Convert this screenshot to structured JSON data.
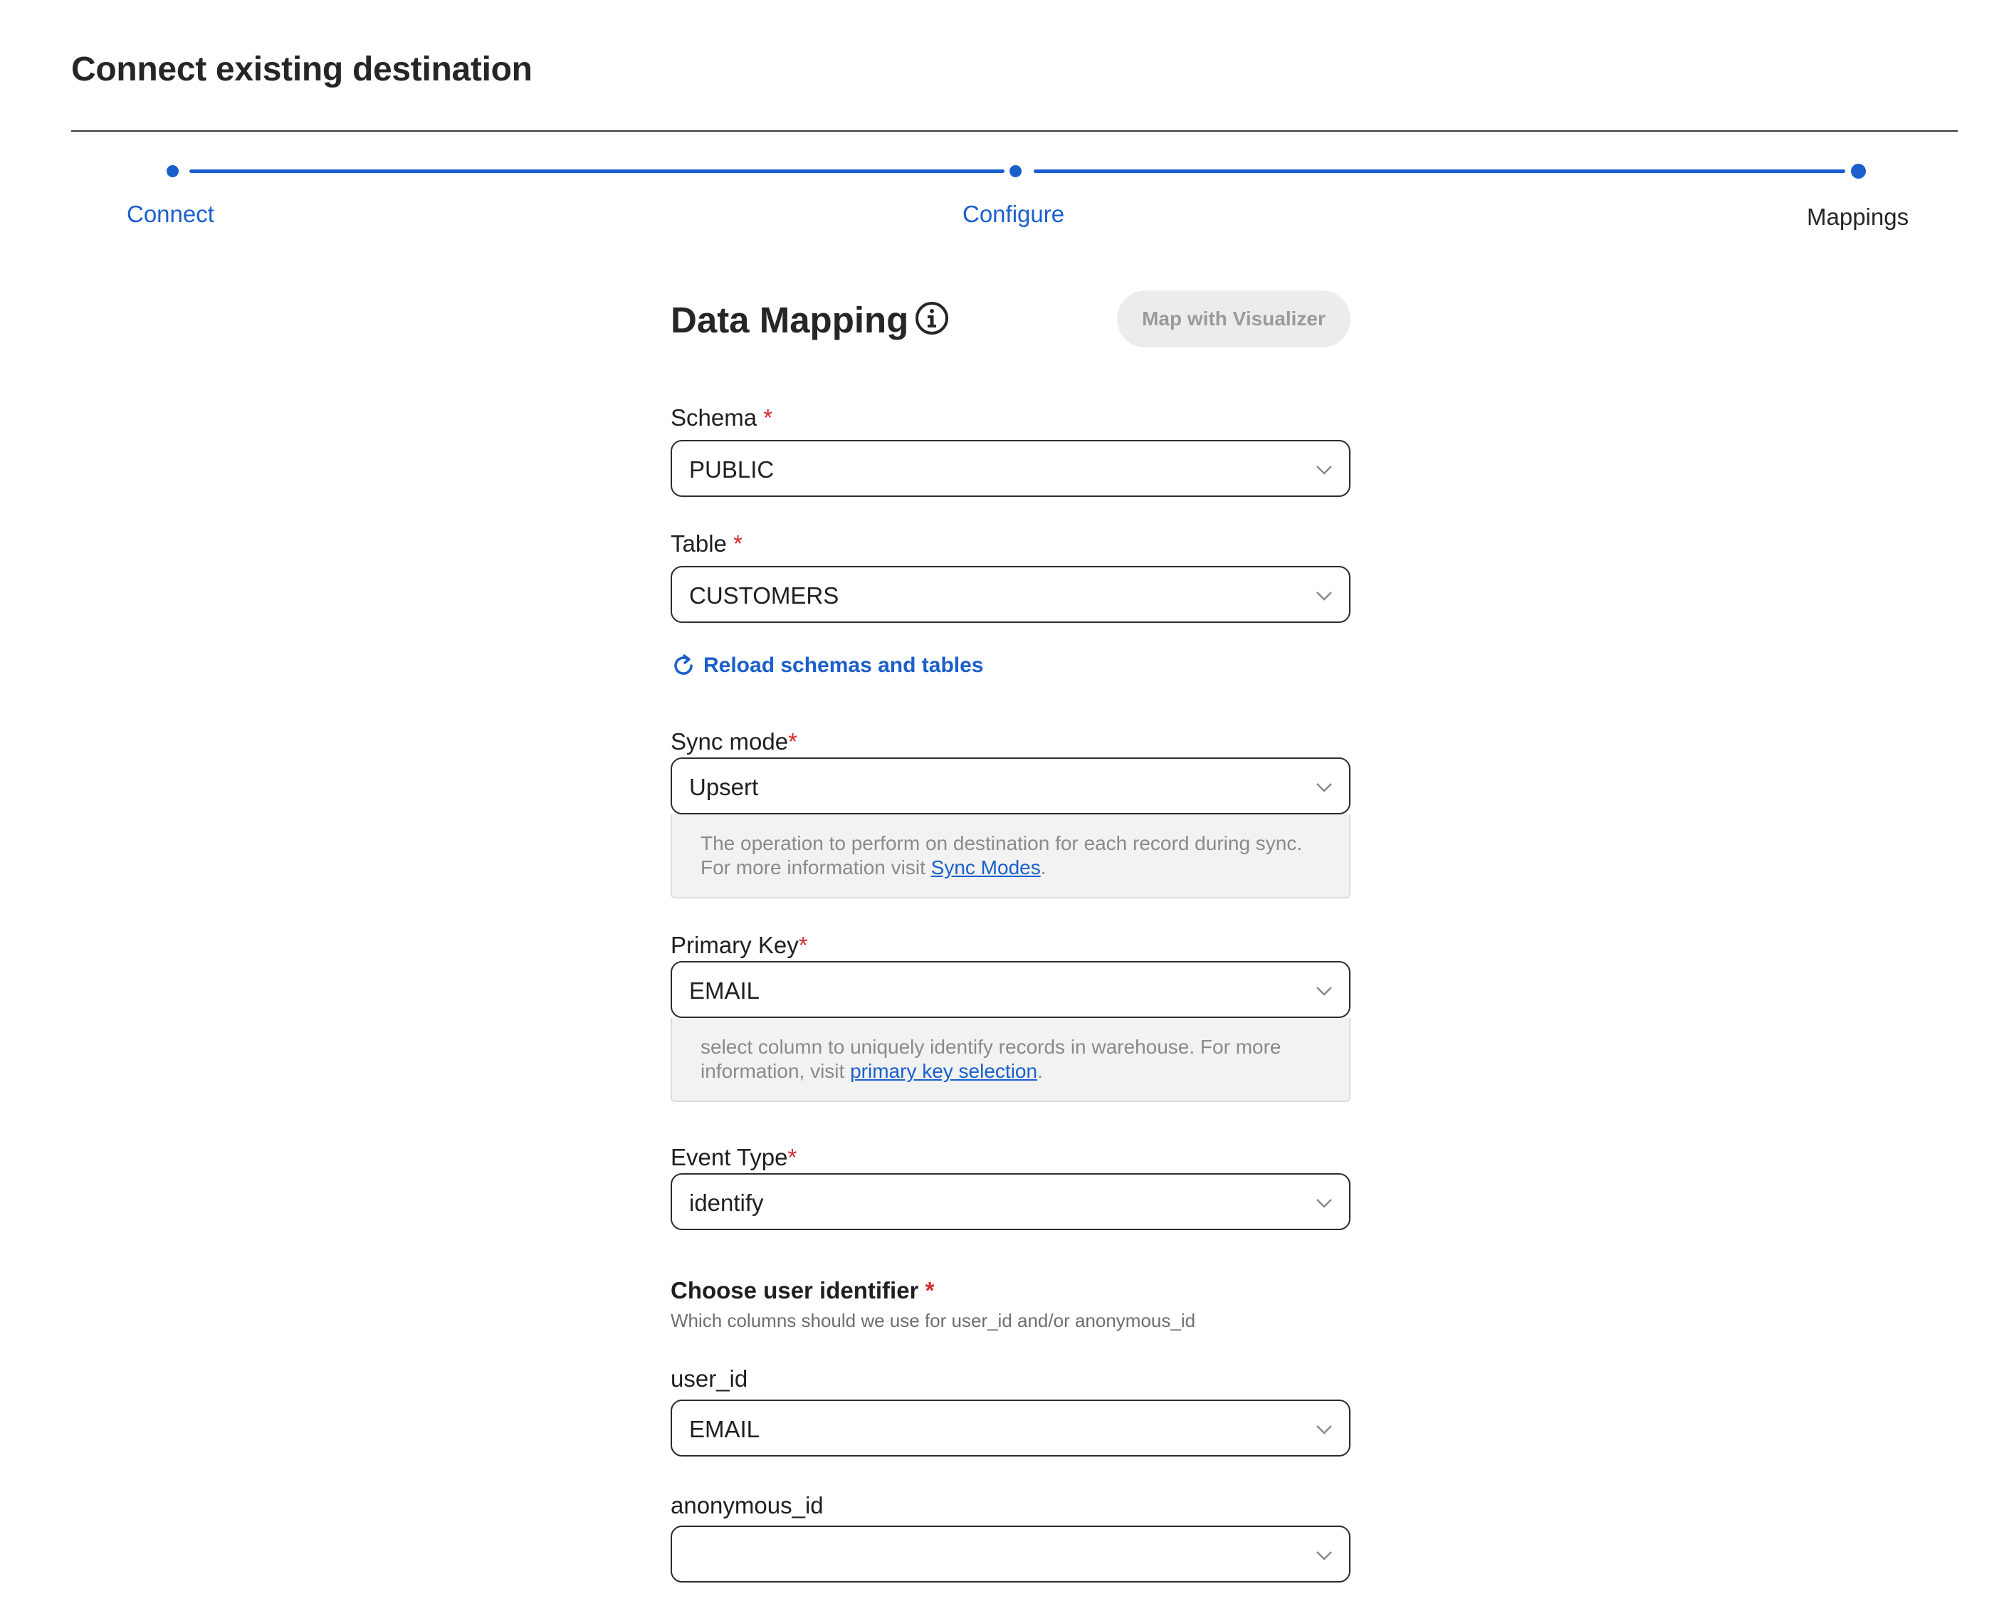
{
  "page": {
    "title": "Connect existing destination"
  },
  "stepper": {
    "steps": [
      {
        "label": "Connect",
        "state": "done"
      },
      {
        "label": "Configure",
        "state": "done"
      },
      {
        "label": "Mappings",
        "state": "current"
      }
    ],
    "accent_color": "#1a5fcc"
  },
  "mapping": {
    "title": "Data Mapping",
    "info_icon": "info-circle-icon",
    "visualizer_button": "Map with Visualizer"
  },
  "fields": {
    "schema": {
      "label": "Schema",
      "required_mark": "*",
      "value": "PUBLIC"
    },
    "table": {
      "label": "Table",
      "required_mark": "*",
      "value": "CUSTOMERS"
    },
    "reload": {
      "label": "Reload schemas and tables",
      "icon": "refresh-icon"
    },
    "sync_mode": {
      "label": "Sync mode",
      "required_mark": "*",
      "value": "Upsert",
      "helper_text": "The operation to perform on destination for each record during sync. For more information visit ",
      "helper_link": "Sync Modes",
      "helper_end": "."
    },
    "primary_key": {
      "label": "Primary Key",
      "required_mark": "*",
      "value": "EMAIL",
      "helper_text": "select column to uniquely identify records in warehouse. For more information, visit ",
      "helper_link": "primary key selection",
      "helper_end": "."
    },
    "event_type": {
      "label": "Event Type",
      "required_mark": "*",
      "value": "identify"
    },
    "user_identifier": {
      "title": "Choose user identifier",
      "required_mark": "*",
      "subtitle": "Which columns should we use for user_id and/or anonymous_id"
    },
    "user_id": {
      "label": "user_id",
      "value": "EMAIL"
    },
    "anonymous_id": {
      "label": "anonymous_id",
      "value": ""
    }
  }
}
